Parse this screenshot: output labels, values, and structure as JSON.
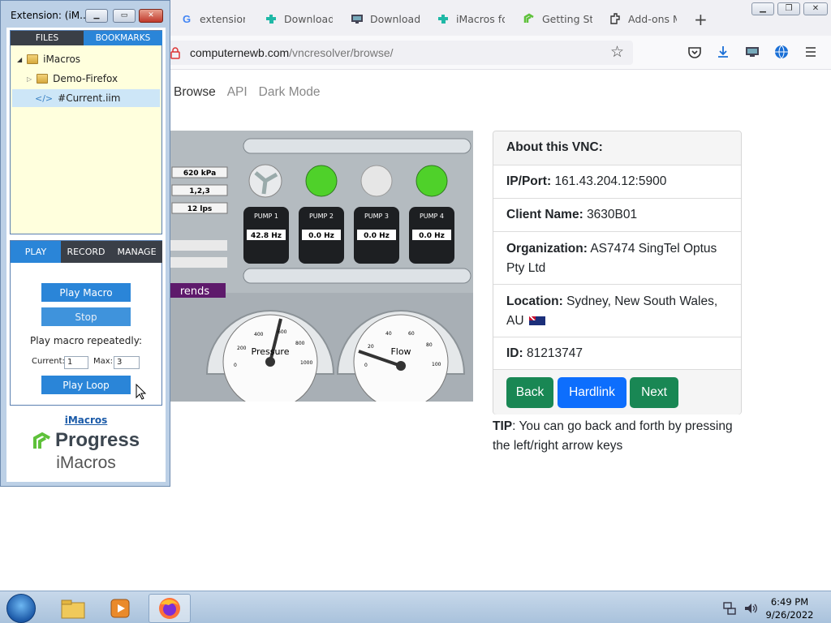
{
  "browser": {
    "tabs": [
      {
        "label": "extensions f",
        "icon": "google-icon"
      },
      {
        "label": "Download A",
        "icon": "puzzle-icon"
      },
      {
        "label": "Download a",
        "icon": "monitor-icon"
      },
      {
        "label": "iMacros for",
        "icon": "puzzle-icon"
      },
      {
        "label": "Getting Star",
        "icon": "progress-icon"
      },
      {
        "label": "Add-ons M",
        "icon": "addon-icon"
      }
    ],
    "new_tab": "+",
    "url_domain": "computernewb.com",
    "url_path": "/vncresolver/browse/"
  },
  "site": {
    "nav": [
      "Browse",
      "API",
      "Dark Mode"
    ],
    "card": {
      "header": "About this VNC:",
      "rows": [
        {
          "label": "IP/Port:",
          "value": "161.43.204.12:5900"
        },
        {
          "label": "Client Name:",
          "value": "3630B01"
        },
        {
          "label": "Organization:",
          "value": "AS7474 SingTel Optus Pty Ltd"
        },
        {
          "label": "Location:",
          "value": "Sydney, New South Wales, AU"
        },
        {
          "label": "ID:",
          "value": "81213747"
        }
      ],
      "buttons": {
        "back": "Back",
        "hardlink": "Hardlink",
        "next": "Next"
      }
    },
    "tip_bold": "TIP",
    "tip_text": ": You can go back and forth by pressing the left/right arrow keys"
  },
  "vnc": {
    "readouts": [
      "620 kPa",
      "1,2,3",
      "12 lps"
    ],
    "pumps": [
      {
        "label": "PUMP 1",
        "value": "42.8 Hz",
        "light": "fan"
      },
      {
        "label": "PUMP 2",
        "value": "0.0 Hz",
        "light": "green"
      },
      {
        "label": "PUMP 3",
        "value": "0.0 Hz",
        "light": "off"
      },
      {
        "label": "PUMP 4",
        "value": "0.0 Hz",
        "light": "green"
      }
    ],
    "trends_label": "rends",
    "gauges": [
      {
        "label": "Pressure",
        "ticks": [
          "0",
          "200",
          "400",
          "600",
          "800",
          "1000"
        ]
      },
      {
        "label": "Flow",
        "ticks": [
          "0",
          "20",
          "40",
          "60",
          "80",
          "100"
        ]
      }
    ]
  },
  "imacros": {
    "title": "Extension: (iM...",
    "panel_tabs": [
      "FILES",
      "BOOKMARKS"
    ],
    "tree": [
      "iMacros",
      "Demo-Firefox",
      "#Current.iim"
    ],
    "mode_tabs": [
      "PLAY",
      "RECORD",
      "MANAGE"
    ],
    "play_macro": "Play Macro",
    "stop": "Stop",
    "repeat_label": "Play macro repeatedly:",
    "current_label": "Current:",
    "current_value": "1",
    "max_label": "Max:",
    "max_value": "3",
    "play_loop": "Play Loop",
    "link": "iMacros",
    "brand": "Progress",
    "product": "iMacros"
  },
  "taskbar": {
    "time": "6:49 PM",
    "date": "9/26/2022"
  },
  "colors": {
    "accent_blue": "#2a85d8",
    "green_button": "#198754",
    "blue_button": "#0d6efd",
    "panel_active_tab": "#2a85d8",
    "panel_dark_tab": "#3a3f47"
  }
}
